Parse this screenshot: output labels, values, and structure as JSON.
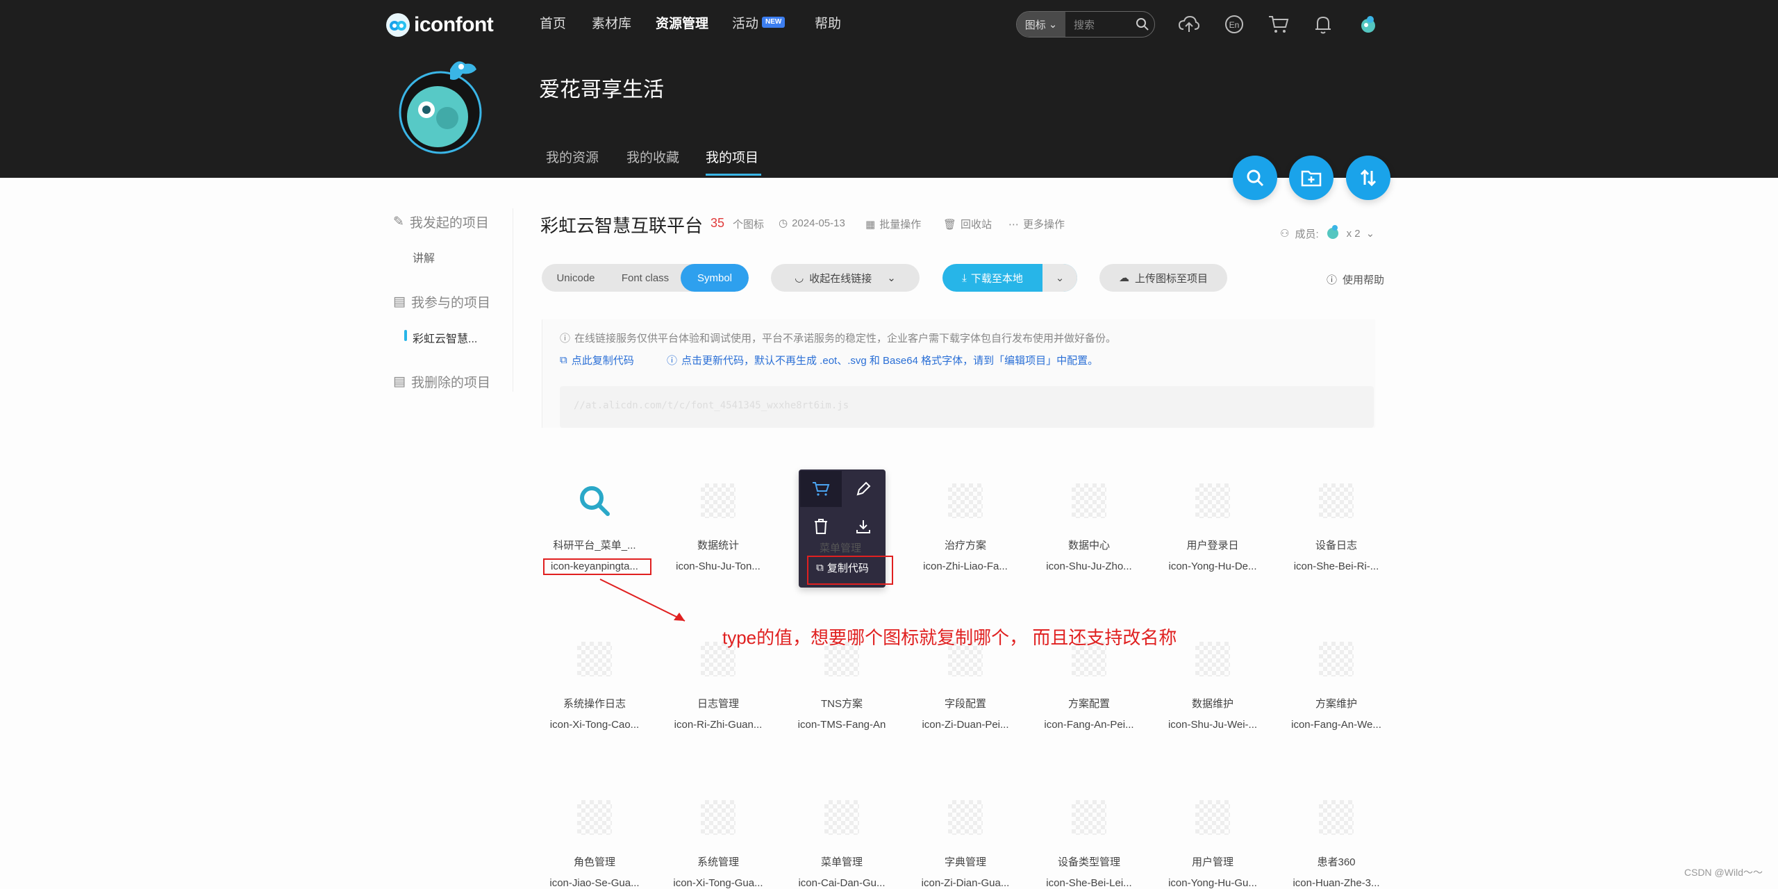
{
  "app": {
    "logo_text": "iconfont"
  },
  "nav": {
    "home": "首页",
    "materials": "素材库",
    "resources": "资源管理",
    "activity": "活动",
    "badge": "NEW",
    "help": "帮助"
  },
  "search": {
    "type": "图标",
    "placeholder": "搜索"
  },
  "topicons": [
    "upload-icon",
    "language-en-icon",
    "cart-icon",
    "bell-icon",
    "user-avatar-icon"
  ],
  "user": {
    "name": "爱花哥享生活"
  },
  "subtabs": [
    "我的资源",
    "我的收藏",
    "我的项目"
  ],
  "sidebar": {
    "started": "我发起的项目",
    "started_sub": "讲解",
    "joined": "我参与的项目",
    "joined_sub": "彩虹云智慧...",
    "deleted": "我删除的项目"
  },
  "project": {
    "title": "彩虹云智慧互联平台",
    "count": "35",
    "count_label": "个图标",
    "date": "2024-05-13",
    "batch": "批量操作",
    "recycle": "回收站",
    "more": "更多操作",
    "members_label": "成员:",
    "members_count": "x 2"
  },
  "toolbar": {
    "seg": [
      "Unicode",
      "Font class",
      "Symbol"
    ],
    "collapse": "收起在线链接",
    "download": "下载至本地",
    "upload": "上传图标至项目",
    "help": "使用帮助"
  },
  "notice": {
    "line1": "在线链接服务仅供平台体验和调试使用，平台不承诺服务的稳定性，企业客户需下载字体包自行发布使用并做好备份。",
    "copy": "点此复制代码",
    "update": "点击更新代码，默认不再生成 .eot、.svg 和 Base64 格式字体，请到「编辑项目」中配置。",
    "code": "//at.alicdn.com/t/c/font_4541345_wxxhe8rt6im.js"
  },
  "hover": {
    "copy": "复制代码",
    "name": "菜单管理"
  },
  "icons": [
    {
      "name": "科研平台_菜单_...",
      "code": "icon-keyanpingta..."
    },
    {
      "name": "数据统计",
      "code": "icon-Shu-Ju-Ton..."
    },
    {
      "name": "",
      "code": ""
    },
    {
      "name": "治疗方案",
      "code": "icon-Zhi-Liao-Fa..."
    },
    {
      "name": "数据中心",
      "code": "icon-Shu-Ju-Zho..."
    },
    {
      "name": "用户登录日",
      "code": "icon-Yong-Hu-De..."
    },
    {
      "name": "设备日志",
      "code": "icon-She-Bei-Ri-..."
    },
    {
      "name": "系统操作日志",
      "code": "icon-Xi-Tong-Cao..."
    },
    {
      "name": "日志管理",
      "code": "icon-Ri-Zhi-Guan..."
    },
    {
      "name": "TNS方案",
      "code": "icon-TMS-Fang-An"
    },
    {
      "name": "字段配置",
      "code": "icon-Zi-Duan-Pei..."
    },
    {
      "name": "方案配置",
      "code": "icon-Fang-An-Pei..."
    },
    {
      "name": "数据维护",
      "code": "icon-Shu-Ju-Wei-..."
    },
    {
      "name": "方案维护",
      "code": "icon-Fang-An-We..."
    },
    {
      "name": "角色管理",
      "code": "icon-Jiao-Se-Gua..."
    },
    {
      "name": "系统管理",
      "code": "icon-Xi-Tong-Gua..."
    },
    {
      "name": "菜单管理",
      "code": "icon-Cai-Dan-Gu..."
    },
    {
      "name": "字典管理",
      "code": "icon-Zi-Dian-Gua..."
    },
    {
      "name": "设备类型管理",
      "code": "icon-She-Bei-Lei..."
    },
    {
      "name": "用户管理",
      "code": "icon-Yong-Hu-Gu..."
    },
    {
      "name": "患者360",
      "code": "icon-Huan-Zhe-3..."
    }
  ],
  "annotation": "type的值，想要哪个图标就复制哪个，  而且还支持改名称",
  "watermark": "CSDN @Wild～～",
  "colors": {
    "accent": "#27b5e8",
    "annotation": "#e02020"
  }
}
